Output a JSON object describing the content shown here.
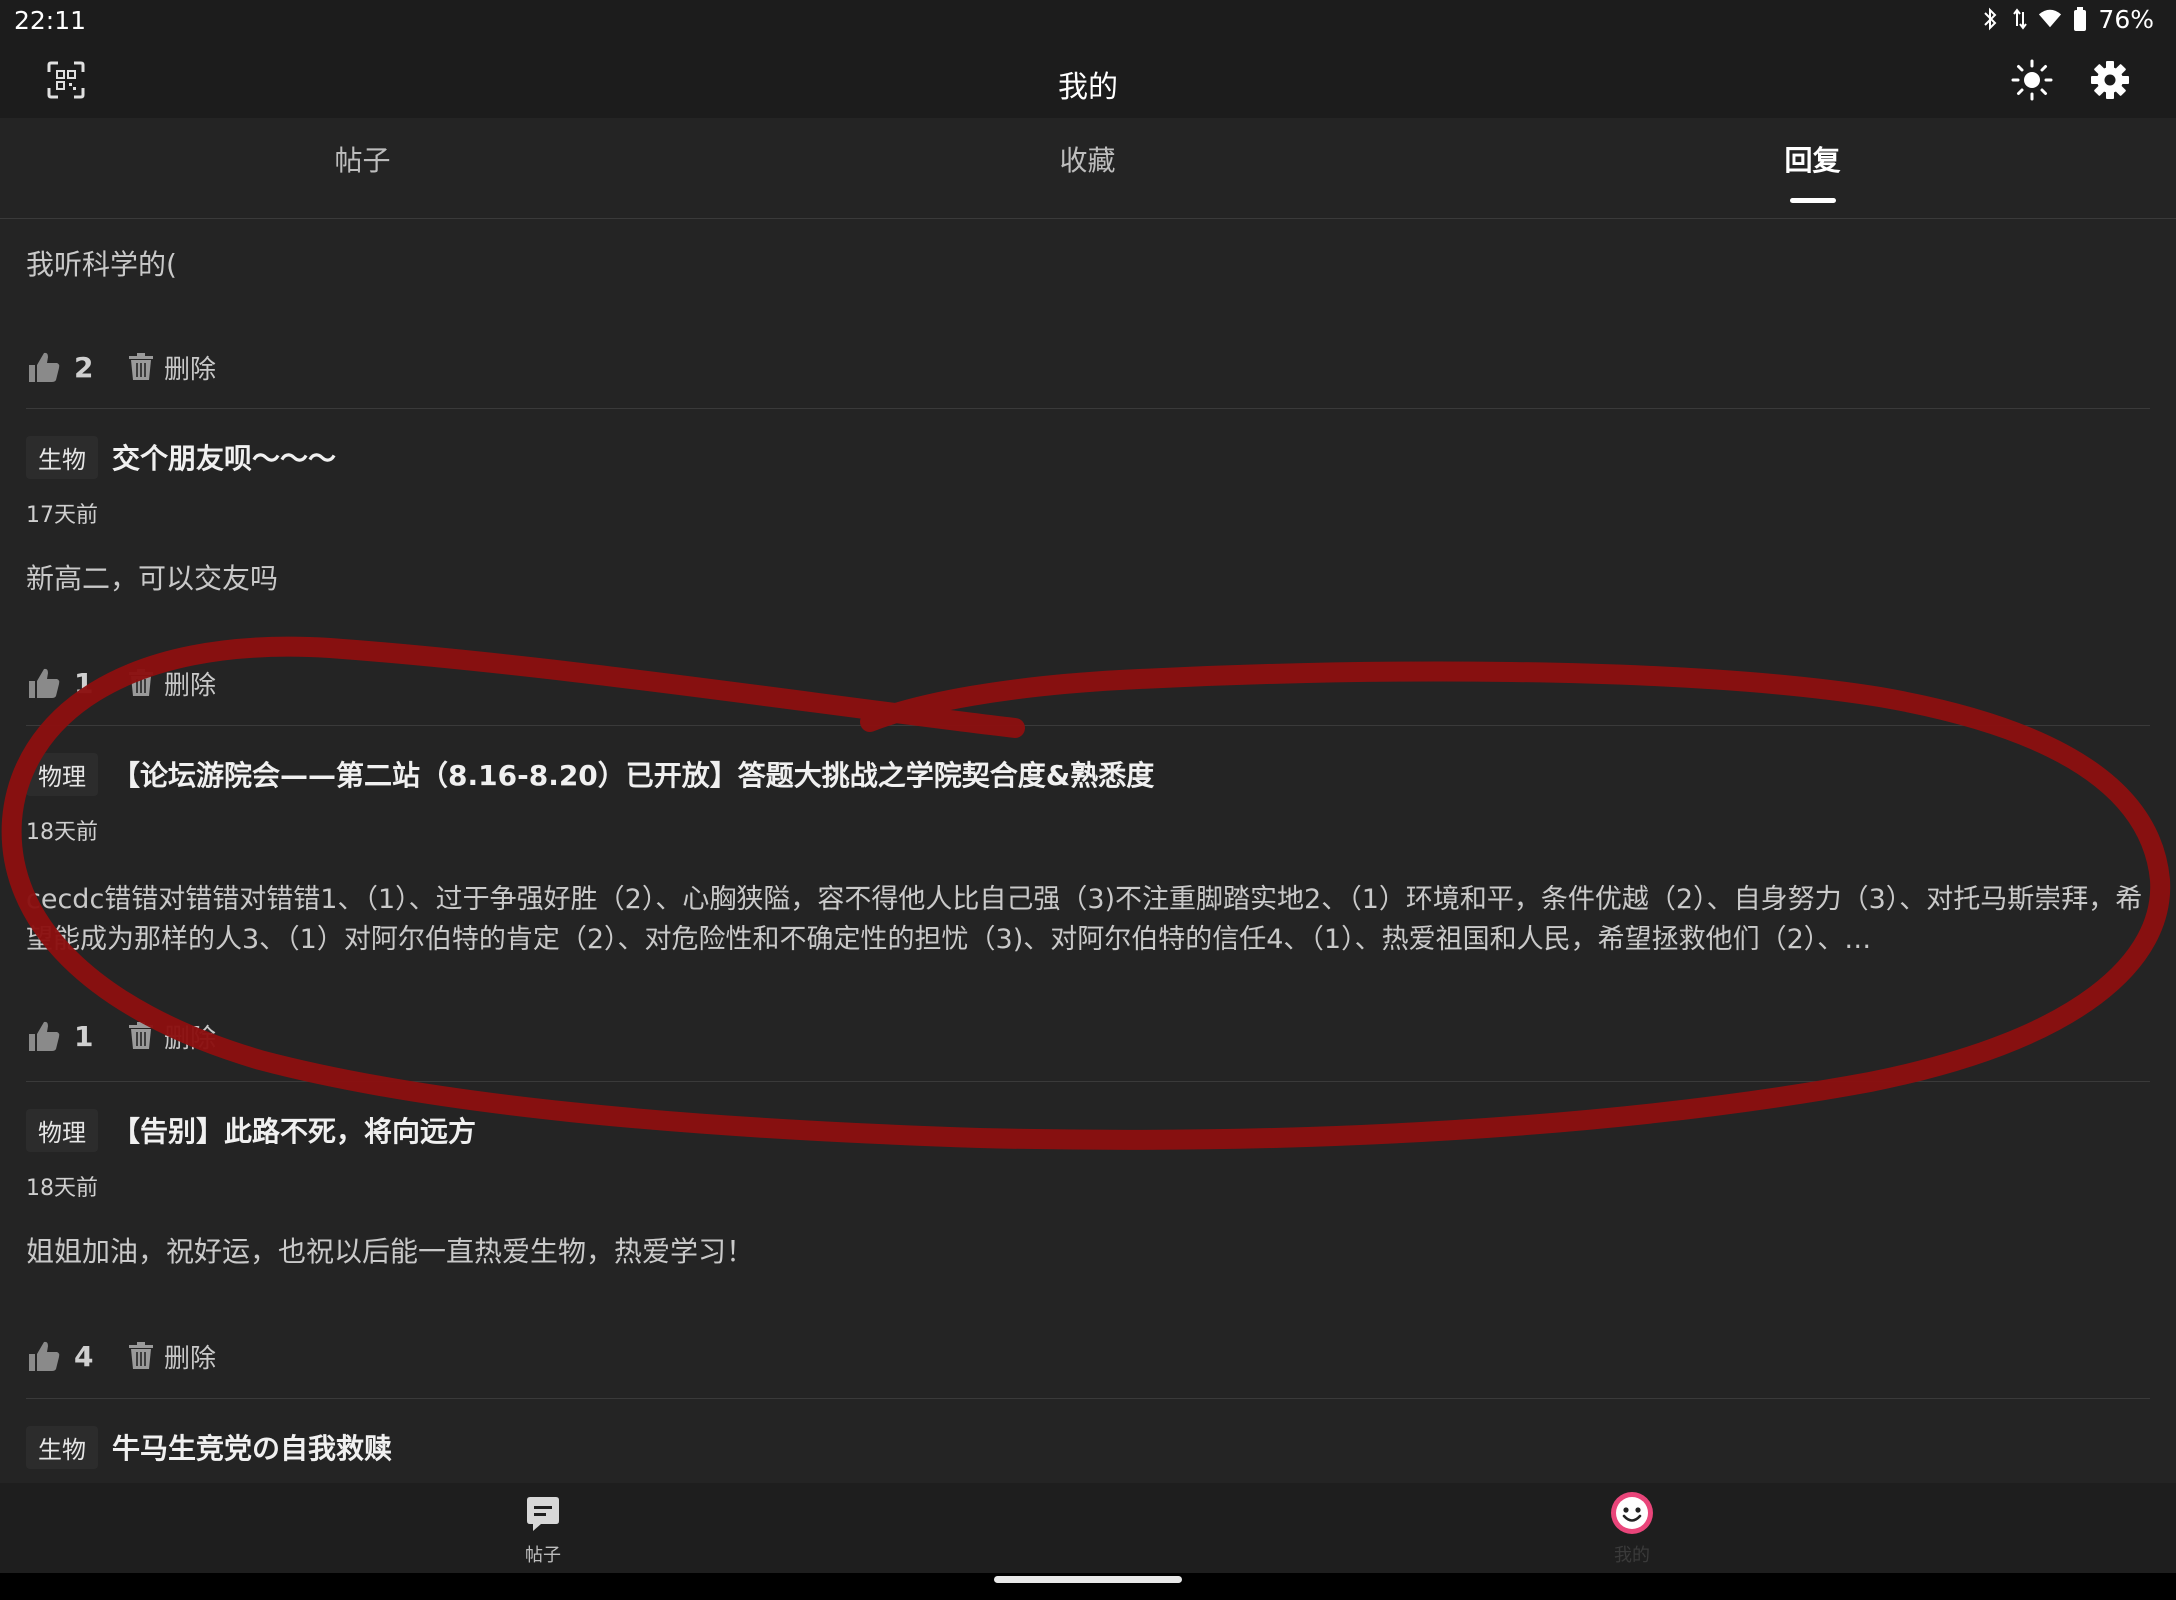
{
  "status_bar": {
    "time": "22:11",
    "battery": "76%"
  },
  "app_bar": {
    "title": "我的",
    "icons": [
      "qr-scan-icon",
      "brightness-icon",
      "gear-icon"
    ]
  },
  "tabs": [
    {
      "label": "帖子",
      "active": false
    },
    {
      "label": "收藏",
      "active": false
    },
    {
      "label": "回复",
      "active": true
    }
  ],
  "replies": [
    {
      "reply": "我听科学的(",
      "likes": "2",
      "delete_label": "删除"
    },
    {
      "tag": "生物",
      "title": "交个朋友呗～～～",
      "time": "17天前",
      "reply": "新高二，可以交友吗",
      "likes": "1",
      "delete_label": "删除"
    },
    {
      "tag": "物理",
      "title": "【论坛游院会——第二站（8.16-8.20）已开放】答题大挑战之学院契合度&熟悉度",
      "time": "18天前",
      "reply": "cecdc错错对错错对错错1、（1）、过于争强好胜（2）、心胸狭隘，容不得他人比自己强（3)不注重脚踏实地2、（1）环境和平，条件优越（2）、自身努力（3）、对托马斯崇拜，希望能成为那样的人3、（1）对阿尔伯特的肯定（2）、对危险性和不确定性的担忧（3)、对阿尔伯特的信任4、（1）、热爱祖国和人民，希望拯救他们（2）、…",
      "likes": "1",
      "delete_label": "删除"
    },
    {
      "tag": "物理",
      "title": "【告别】此路不死，将向远方",
      "time": "18天前",
      "reply": "姐姐加油，祝好运，也祝以后能一直热爱生物，热爱学习！",
      "likes": "4",
      "delete_label": "删除"
    },
    {
      "tag": "生物",
      "title": "牛马生竞党の自我救赎"
    }
  ],
  "bottom_nav": [
    {
      "label": "帖子",
      "icon": "posts-icon",
      "active": false
    },
    {
      "label": "我的",
      "icon": "smiley-avatar-icon",
      "active": true
    }
  ],
  "colors": {
    "background": "#242424",
    "bar": "#1c1c1c",
    "annotation": "#8b1010",
    "avatar_ring": "#e9457a"
  }
}
